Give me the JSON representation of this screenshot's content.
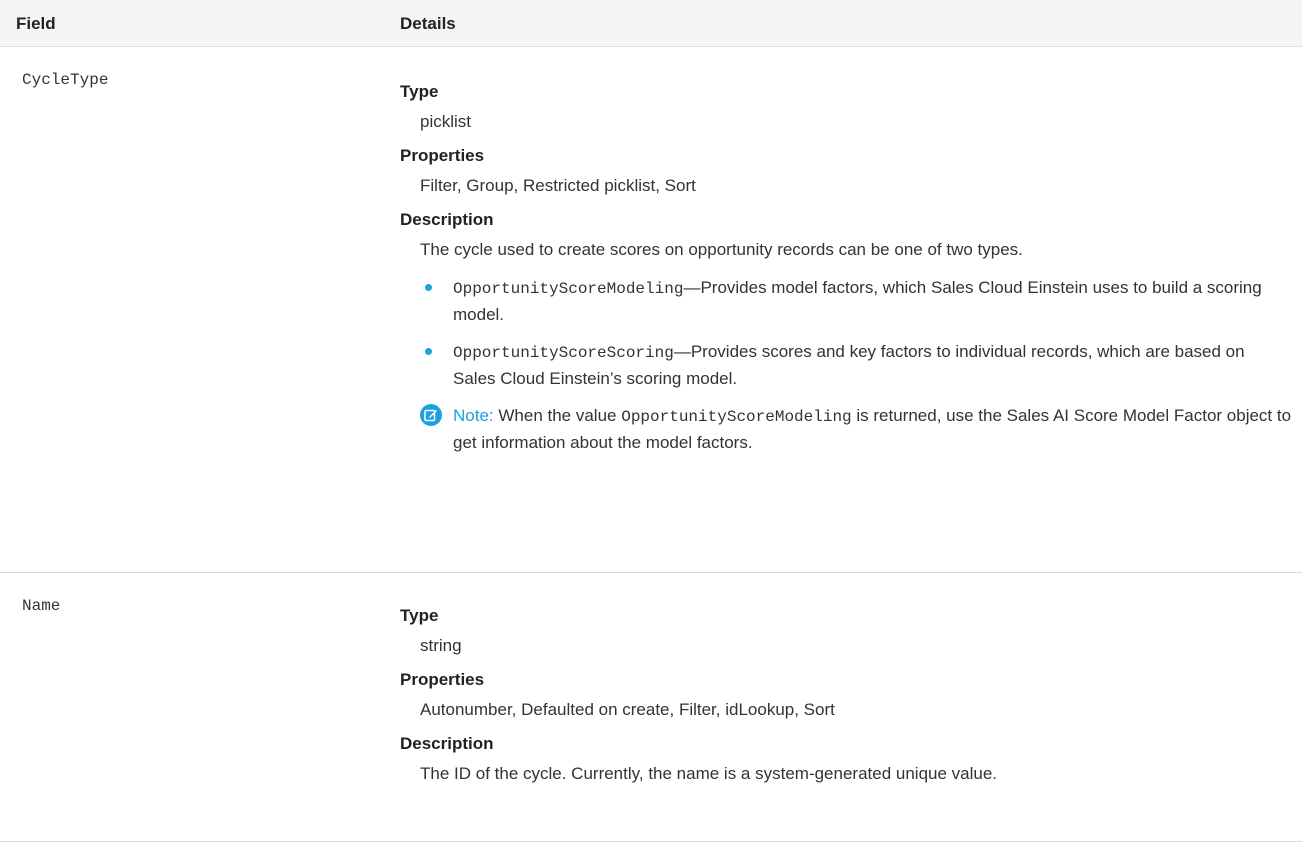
{
  "header": {
    "field": "Field",
    "details": "Details"
  },
  "rows": [
    {
      "field": "CycleType",
      "type_label": "Type",
      "type_value": "picklist",
      "properties_label": "Properties",
      "properties_value": "Filter, Group, Restricted picklist, Sort",
      "description_label": "Description",
      "description_text": "The cycle used to create scores on opportunity records can be one of two types.",
      "bullets": [
        {
          "code": "OpportunityScoreModeling",
          "text": "—Provides model factors, which Sales Cloud Einstein uses to build a scoring model."
        },
        {
          "code": "OpportunityScoreScoring",
          "text": "—Provides scores and key factors to individual records, which are based on Sales Cloud Einstein’s scoring model."
        }
      ],
      "note": {
        "icon": "edit-icon",
        "label": "Note:",
        "text_before": " When the value ",
        "code": "OpportunityScoreModeling",
        "text_after": " is returned, use the Sales AI Score Model Factor object to get information about the model factors."
      }
    },
    {
      "field": "Name",
      "type_label": "Type",
      "type_value": "string",
      "properties_label": "Properties",
      "properties_value": "Autonumber, Defaulted on create, Filter, idLookup, Sort",
      "description_label": "Description",
      "description_text": "The ID of the cycle. Currently, the name is a system-generated unique value."
    }
  ],
  "colors": {
    "accent": "#1ba1e2",
    "header_bg": "#f5f5f5"
  }
}
